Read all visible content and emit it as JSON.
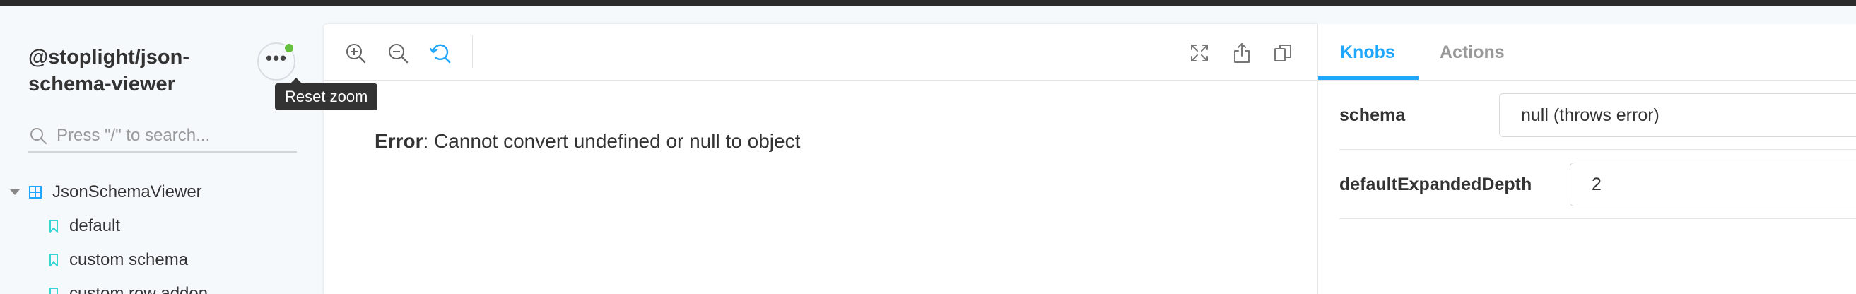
{
  "sidebar": {
    "title": "@stoplight/json-schema-viewer",
    "menu_glyph": "•••",
    "tooltip": "Reset zoom",
    "search_placeholder": "Press \"/\" to search...",
    "tree": {
      "component": "JsonSchemaViewer",
      "stories": [
        "default",
        "custom schema",
        "custom row addon"
      ]
    }
  },
  "canvas": {
    "toolbar": {
      "zoom_in": "zoom-in-icon",
      "zoom_out": "zoom-out-icon",
      "reset_zoom": "reset-zoom-icon",
      "fullscreen": "fullscreen-icon",
      "share": "share-icon",
      "copy": "copy-icon"
    },
    "error_label": "Error",
    "error_message": ": Cannot convert undefined or null to object"
  },
  "addons": {
    "tabs": [
      {
        "label": "Knobs",
        "active": true
      },
      {
        "label": "Actions",
        "active": false
      }
    ],
    "knobs": [
      {
        "label": "schema",
        "value": "null (throws error)"
      },
      {
        "label": "defaultExpandedDepth",
        "value": "2"
      }
    ]
  },
  "colors": {
    "accent": "#1ea7fd",
    "status_dot": "#66bf3c",
    "story_icon": "#37d5d3",
    "component_icon": "#1ea7fd"
  }
}
